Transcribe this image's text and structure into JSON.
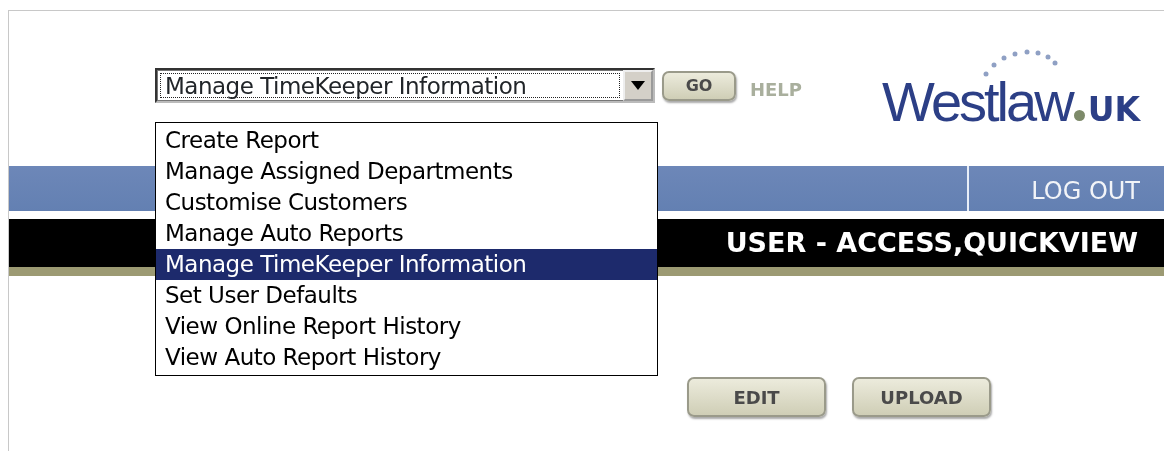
{
  "header": {
    "select": {
      "value": "Manage TimeKeeper Information",
      "expanded": true
    },
    "go_button": "GO",
    "help_link": "HELP",
    "logo": {
      "name": "Westlaw",
      "suffix": "UK"
    }
  },
  "dropdown_options": [
    {
      "label": "Create Report",
      "selected": false
    },
    {
      "label": "Manage Assigned Departments",
      "selected": false
    },
    {
      "label": "Customise Customers",
      "selected": false
    },
    {
      "label": "Manage Auto Reports",
      "selected": false
    },
    {
      "label": "Manage TimeKeeper Information",
      "selected": true
    },
    {
      "label": "Set User Defaults",
      "selected": false
    },
    {
      "label": "View Online Report History",
      "selected": false
    },
    {
      "label": "View Auto Report History",
      "selected": false
    }
  ],
  "nav_bar": {
    "logout": "LOG OUT"
  },
  "title_bar": {
    "title": "USER - ACCESS,QUICKVIEW"
  },
  "buttons": [
    "EDIT",
    "UPLOAD"
  ]
}
